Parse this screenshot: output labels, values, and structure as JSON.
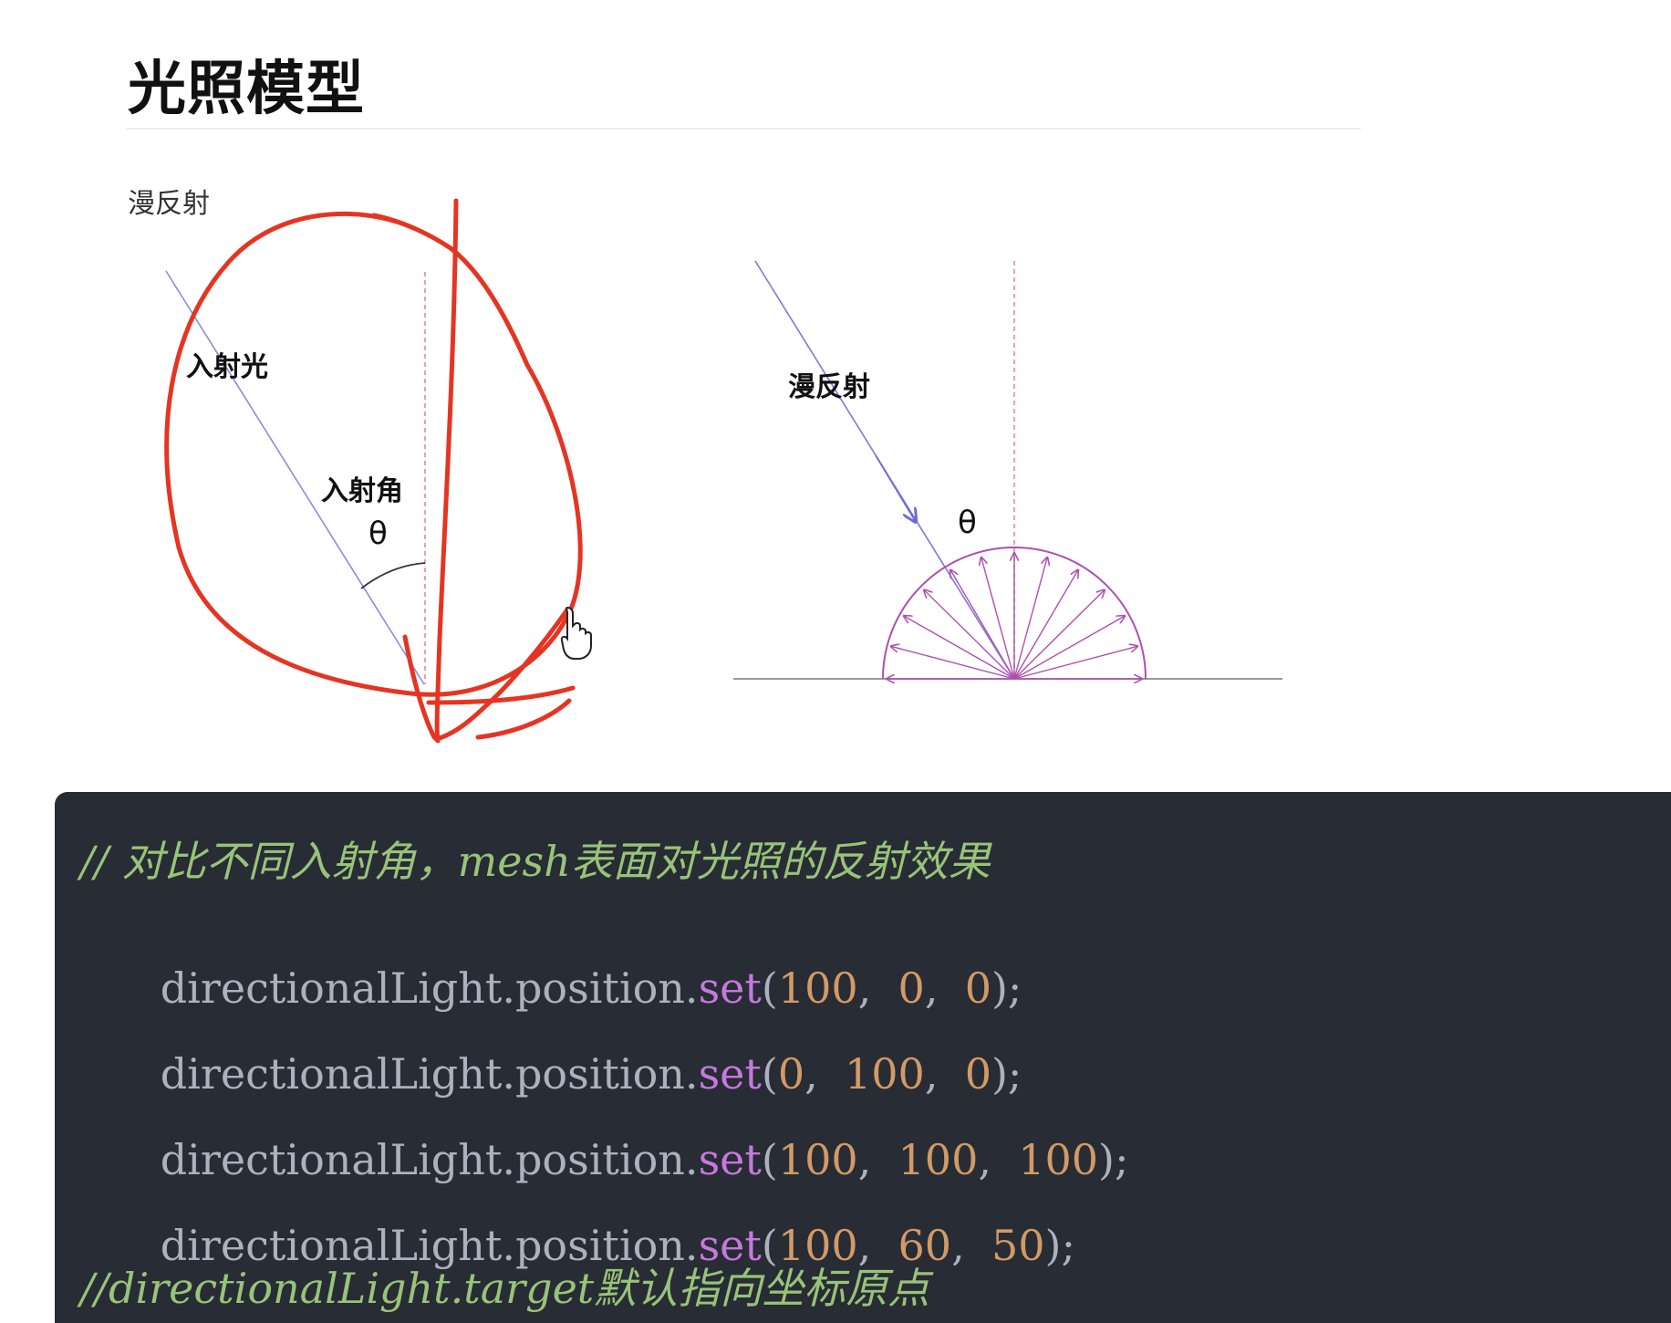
{
  "header": {
    "title": "光照模型",
    "section_label": "漫反射"
  },
  "figure_left": {
    "incident_light_label": "入射光",
    "incident_angle_label": "入射角",
    "theta_symbol": "θ"
  },
  "figure_right": {
    "diffuse_label": "漫反射",
    "theta_symbol": "θ"
  },
  "code": {
    "comment_1": "// 对比不同入射角，mesh表面对光照的反射效果",
    "lines": [
      {
        "object": "directionalLight.position.",
        "method": "set",
        "open": "(",
        "args": [
          "100",
          "0",
          "0"
        ],
        "close": ");"
      },
      {
        "object": "directionalLight.position.",
        "method": "set",
        "open": "(",
        "args": [
          "0",
          "100",
          "0"
        ],
        "close": ");"
      },
      {
        "object": "directionalLight.position.",
        "method": "set",
        "open": "(",
        "args": [
          "100",
          "100",
          "100"
        ],
        "close": ");"
      },
      {
        "object": "directionalLight.position.",
        "method": "set",
        "open": "(",
        "args": [
          "100",
          "60",
          "50"
        ],
        "close": ");"
      }
    ],
    "comment_2": "//directionalLight.target默认指向坐标原点",
    "separator": ",  "
  },
  "colors": {
    "code_background": "#282c34",
    "comment": "#98c379",
    "method": "#c678dd",
    "number": "#d19a66",
    "plain": "#abb2bf",
    "annotation_red": "#e53522",
    "ray_blue": "#7a7adf",
    "normal_red_dashed": "#e58a8a",
    "hemisphere_purple": "#b04fb0"
  }
}
